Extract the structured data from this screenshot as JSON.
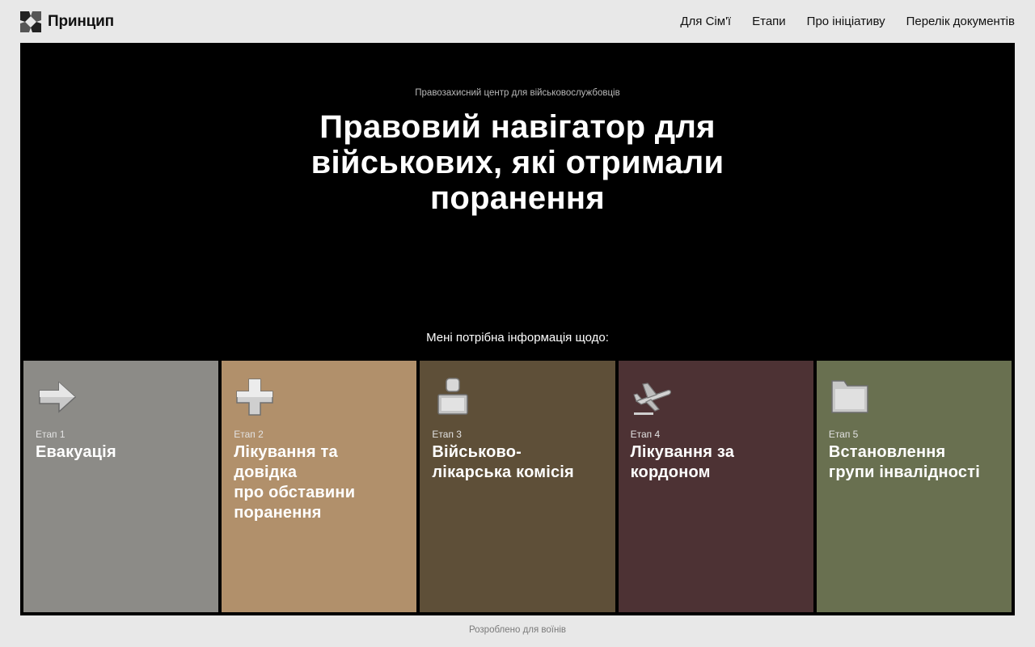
{
  "header": {
    "logo_text": "Принцип",
    "nav": [
      {
        "label": "Для Сім'ї"
      },
      {
        "label": "Етапи"
      },
      {
        "label": "Про ініціативу"
      },
      {
        "label": "Перелік документів"
      }
    ]
  },
  "hero": {
    "eyebrow": "Правозахисний центр для військовослужбовців",
    "title": "Правовий навігатор для військових, які отримали поранення",
    "prompt": "Мені потрібна інформація щодо:"
  },
  "cards": [
    {
      "stage": "Етап 1",
      "label": "Евакуація",
      "icon": "arrow-right-icon",
      "color": "#8c8b87"
    },
    {
      "stage": "Етап 2",
      "label": "Лікування та\nдовідка\nпро обставини\nпоранення",
      "icon": "medical-cross-icon",
      "color": "#b1906b"
    },
    {
      "stage": "Етап 3",
      "label": "Військово-\nлікарська комісія",
      "icon": "person-icon",
      "color": "#5e4f38"
    },
    {
      "stage": "Етап 4",
      "label": "Лікування за\nкордоном",
      "icon": "airplane-icon",
      "color": "#4d3234"
    },
    {
      "stage": "Етап 5",
      "label": "Встановлення\nгрупи інвалідності",
      "icon": "folder-icon",
      "color": "#697050"
    }
  ],
  "footer": {
    "text": "Розроблено для воїнів"
  }
}
